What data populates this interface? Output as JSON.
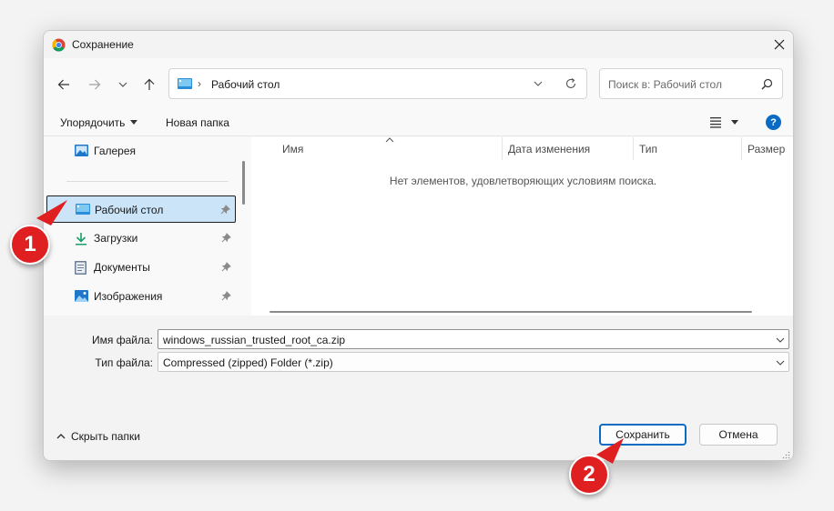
{
  "window": {
    "title": "Сохранение"
  },
  "address": {
    "path": "Рабочий стол",
    "separator": "›"
  },
  "search": {
    "placeholder": "Поиск в: Рабочий стол"
  },
  "toolbar": {
    "organize": "Упорядочить",
    "new_folder": "Новая папка",
    "help": "?"
  },
  "sidebar": {
    "items": [
      {
        "label": "Галерея",
        "icon": "gallery-icon"
      },
      {
        "label": "Рабочий стол",
        "icon": "desktop-icon",
        "pinned": true,
        "selected": true
      },
      {
        "label": "Загрузки",
        "icon": "downloads-icon",
        "pinned": true
      },
      {
        "label": "Документы",
        "icon": "documents-icon",
        "pinned": true
      },
      {
        "label": "Изображения",
        "icon": "pictures-icon",
        "pinned": true
      }
    ]
  },
  "files": {
    "columns": [
      "Имя",
      "Дата изменения",
      "Тип",
      "Размер"
    ],
    "empty_message": "Нет элементов, удовлетворяющих условиям поиска."
  },
  "form": {
    "filename_label": "Имя файла:",
    "filename_value": "windows_russian_trusted_root_ca.zip",
    "filetype_label": "Тип файла:",
    "filetype_value": "Compressed (zipped) Folder (*.zip)"
  },
  "footer": {
    "hide_folders": "Скрыть папки",
    "save": "Сохранить",
    "cancel": "Отмена"
  },
  "annotations": {
    "badge1": "1",
    "badge2": "2",
    "color": "#e02020"
  },
  "colors": {
    "accent": "#0b6bc2",
    "selection": "#cce4f7"
  }
}
